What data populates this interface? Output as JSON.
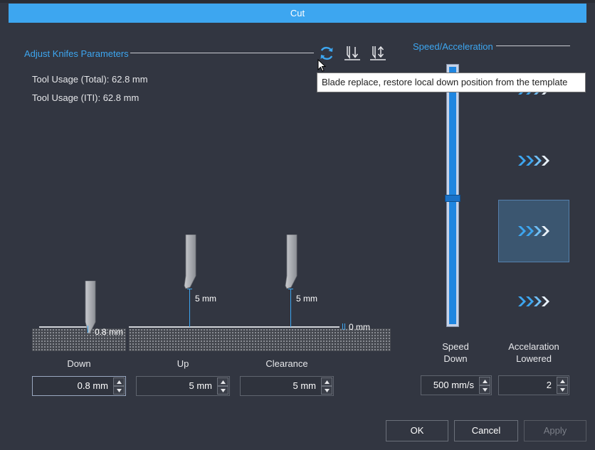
{
  "window": {
    "title": "Cut"
  },
  "knife_section": {
    "title": "Adjust Knifes Parameters",
    "tool_usage_total": "Tool Usage (Total): 62.8 mm",
    "tool_usage_iti": "Tool Usage (ITI): 62.8 mm",
    "tooltip": "Blade replace, restore local down position from the template",
    "icons": [
      "refresh-icon",
      "knife-down-icon",
      "knife-up-down-icon"
    ]
  },
  "diagram": {
    "down_label": "0.8 mm",
    "up_label": "5 mm",
    "clearance_label": "5 mm",
    "zero_label": "0 mm"
  },
  "fields": {
    "down": {
      "label": "Down",
      "value": "0.8 mm"
    },
    "up": {
      "label": "Up",
      "value": "5 mm"
    },
    "clearance": {
      "label": "Clearance",
      "value": "5 mm"
    }
  },
  "speed_section": {
    "title": "Speed/Acceleration",
    "speed_label_1": "Speed",
    "speed_label_2": "Down",
    "speed_value": "500 mm/s",
    "accel_label_1": "Accelaration",
    "accel_label_2": "Lowered",
    "accel_value": "2",
    "accel_selected_level": 2,
    "accel_level_count": 4,
    "speed_slider_fraction": 0.49
  },
  "buttons": {
    "ok": "OK",
    "cancel": "Cancel",
    "apply": "Apply"
  },
  "colors": {
    "accent": "#3da6f0",
    "background": "#323641",
    "slider_fill": "#1f86e0"
  }
}
